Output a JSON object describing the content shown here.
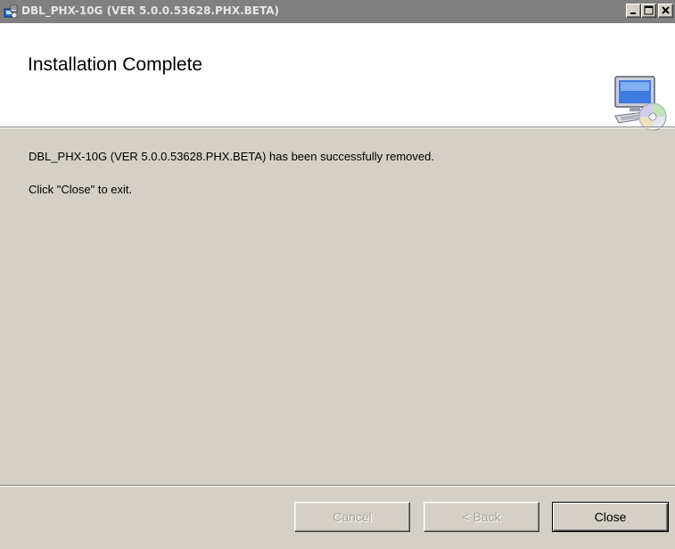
{
  "window": {
    "title": "DBL_PHX-10G (VER 5.0.0.53628.PHX.BETA)"
  },
  "header": {
    "title": "Installation Complete",
    "icon": "computer-cd-icon"
  },
  "body": {
    "message": "DBL_PHX-10G (VER 5.0.0.53628.PHX.BETA) has been successfully removed.",
    "instruction": "Click \"Close\" to exit."
  },
  "buttons": {
    "cancel": "Cancel",
    "back": "< Back",
    "close": "Close"
  },
  "colors": {
    "titlebar_inactive": "#808080",
    "dialog_face": "#d4d0c8",
    "header_bg": "#ffffff"
  }
}
